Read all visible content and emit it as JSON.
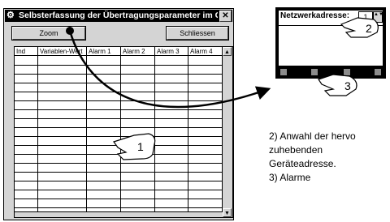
{
  "window": {
    "title": "Selbsterfassung der Übertragungsparameter im Gange...",
    "close_glyph": "✕",
    "system_icon": "⚙"
  },
  "toolbar": {
    "zoom_label": "Zoom",
    "close_label": "Schliessen"
  },
  "table": {
    "columns": [
      "Ind",
      "Variablen-Wert",
      "Alarm 1",
      "Alarm 2",
      "Alarm 3",
      "Alarm 4"
    ],
    "scroll_up": "▲",
    "scroll_down": "▼"
  },
  "zoom_window": {
    "label": "Netzwerkadresse:",
    "address_value": "1",
    "spin_glyph": "▲▼"
  },
  "callouts": {
    "c1": "1",
    "c2": "2",
    "c3": "3"
  },
  "caption": {
    "line1": "2) Anwahl der hervo",
    "line2": "zuhebenden",
    "line3": "Geräteadresse.",
    "line4": "3) Alarme"
  }
}
